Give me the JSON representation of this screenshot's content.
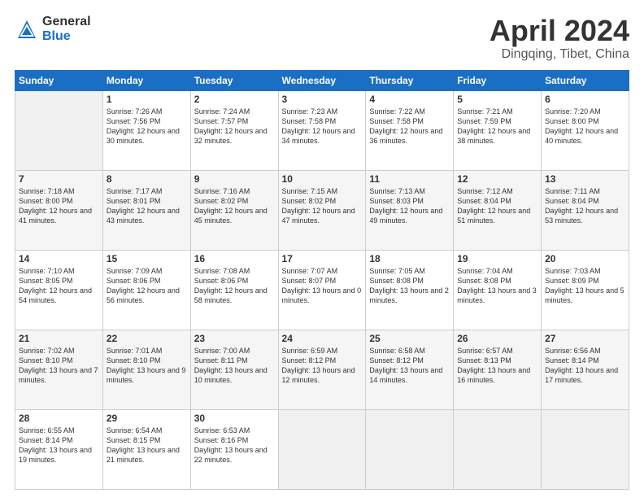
{
  "header": {
    "logo_general": "General",
    "logo_blue": "Blue",
    "title": "April 2024",
    "subtitle": "Dingqing, Tibet, China"
  },
  "weekdays": [
    "Sunday",
    "Monday",
    "Tuesday",
    "Wednesday",
    "Thursday",
    "Friday",
    "Saturday"
  ],
  "weeks": [
    [
      {
        "day": "",
        "sunrise": "",
        "sunset": "",
        "daylight": ""
      },
      {
        "day": "1",
        "sunrise": "Sunrise: 7:26 AM",
        "sunset": "Sunset: 7:56 PM",
        "daylight": "Daylight: 12 hours and 30 minutes."
      },
      {
        "day": "2",
        "sunrise": "Sunrise: 7:24 AM",
        "sunset": "Sunset: 7:57 PM",
        "daylight": "Daylight: 12 hours and 32 minutes."
      },
      {
        "day": "3",
        "sunrise": "Sunrise: 7:23 AM",
        "sunset": "Sunset: 7:58 PM",
        "daylight": "Daylight: 12 hours and 34 minutes."
      },
      {
        "day": "4",
        "sunrise": "Sunrise: 7:22 AM",
        "sunset": "Sunset: 7:58 PM",
        "daylight": "Daylight: 12 hours and 36 minutes."
      },
      {
        "day": "5",
        "sunrise": "Sunrise: 7:21 AM",
        "sunset": "Sunset: 7:59 PM",
        "daylight": "Daylight: 12 hours and 38 minutes."
      },
      {
        "day": "6",
        "sunrise": "Sunrise: 7:20 AM",
        "sunset": "Sunset: 8:00 PM",
        "daylight": "Daylight: 12 hours and 40 minutes."
      }
    ],
    [
      {
        "day": "7",
        "sunrise": "Sunrise: 7:18 AM",
        "sunset": "Sunset: 8:00 PM",
        "daylight": "Daylight: 12 hours and 41 minutes."
      },
      {
        "day": "8",
        "sunrise": "Sunrise: 7:17 AM",
        "sunset": "Sunset: 8:01 PM",
        "daylight": "Daylight: 12 hours and 43 minutes."
      },
      {
        "day": "9",
        "sunrise": "Sunrise: 7:16 AM",
        "sunset": "Sunset: 8:02 PM",
        "daylight": "Daylight: 12 hours and 45 minutes."
      },
      {
        "day": "10",
        "sunrise": "Sunrise: 7:15 AM",
        "sunset": "Sunset: 8:02 PM",
        "daylight": "Daylight: 12 hours and 47 minutes."
      },
      {
        "day": "11",
        "sunrise": "Sunrise: 7:13 AM",
        "sunset": "Sunset: 8:03 PM",
        "daylight": "Daylight: 12 hours and 49 minutes."
      },
      {
        "day": "12",
        "sunrise": "Sunrise: 7:12 AM",
        "sunset": "Sunset: 8:04 PM",
        "daylight": "Daylight: 12 hours and 51 minutes."
      },
      {
        "day": "13",
        "sunrise": "Sunrise: 7:11 AM",
        "sunset": "Sunset: 8:04 PM",
        "daylight": "Daylight: 12 hours and 53 minutes."
      }
    ],
    [
      {
        "day": "14",
        "sunrise": "Sunrise: 7:10 AM",
        "sunset": "Sunset: 8:05 PM",
        "daylight": "Daylight: 12 hours and 54 minutes."
      },
      {
        "day": "15",
        "sunrise": "Sunrise: 7:09 AM",
        "sunset": "Sunset: 8:06 PM",
        "daylight": "Daylight: 12 hours and 56 minutes."
      },
      {
        "day": "16",
        "sunrise": "Sunrise: 7:08 AM",
        "sunset": "Sunset: 8:06 PM",
        "daylight": "Daylight: 12 hours and 58 minutes."
      },
      {
        "day": "17",
        "sunrise": "Sunrise: 7:07 AM",
        "sunset": "Sunset: 8:07 PM",
        "daylight": "Daylight: 13 hours and 0 minutes."
      },
      {
        "day": "18",
        "sunrise": "Sunrise: 7:05 AM",
        "sunset": "Sunset: 8:08 PM",
        "daylight": "Daylight: 13 hours and 2 minutes."
      },
      {
        "day": "19",
        "sunrise": "Sunrise: 7:04 AM",
        "sunset": "Sunset: 8:08 PM",
        "daylight": "Daylight: 13 hours and 3 minutes."
      },
      {
        "day": "20",
        "sunrise": "Sunrise: 7:03 AM",
        "sunset": "Sunset: 8:09 PM",
        "daylight": "Daylight: 13 hours and 5 minutes."
      }
    ],
    [
      {
        "day": "21",
        "sunrise": "Sunrise: 7:02 AM",
        "sunset": "Sunset: 8:10 PM",
        "daylight": "Daylight: 13 hours and 7 minutes."
      },
      {
        "day": "22",
        "sunrise": "Sunrise: 7:01 AM",
        "sunset": "Sunset: 8:10 PM",
        "daylight": "Daylight: 13 hours and 9 minutes."
      },
      {
        "day": "23",
        "sunrise": "Sunrise: 7:00 AM",
        "sunset": "Sunset: 8:11 PM",
        "daylight": "Daylight: 13 hours and 10 minutes."
      },
      {
        "day": "24",
        "sunrise": "Sunrise: 6:59 AM",
        "sunset": "Sunset: 8:12 PM",
        "daylight": "Daylight: 13 hours and 12 minutes."
      },
      {
        "day": "25",
        "sunrise": "Sunrise: 6:58 AM",
        "sunset": "Sunset: 8:12 PM",
        "daylight": "Daylight: 13 hours and 14 minutes."
      },
      {
        "day": "26",
        "sunrise": "Sunrise: 6:57 AM",
        "sunset": "Sunset: 8:13 PM",
        "daylight": "Daylight: 13 hours and 16 minutes."
      },
      {
        "day": "27",
        "sunrise": "Sunrise: 6:56 AM",
        "sunset": "Sunset: 8:14 PM",
        "daylight": "Daylight: 13 hours and 17 minutes."
      }
    ],
    [
      {
        "day": "28",
        "sunrise": "Sunrise: 6:55 AM",
        "sunset": "Sunset: 8:14 PM",
        "daylight": "Daylight: 13 hours and 19 minutes."
      },
      {
        "day": "29",
        "sunrise": "Sunrise: 6:54 AM",
        "sunset": "Sunset: 8:15 PM",
        "daylight": "Daylight: 13 hours and 21 minutes."
      },
      {
        "day": "30",
        "sunrise": "Sunrise: 6:53 AM",
        "sunset": "Sunset: 8:16 PM",
        "daylight": "Daylight: 13 hours and 22 minutes."
      },
      {
        "day": "",
        "sunrise": "",
        "sunset": "",
        "daylight": ""
      },
      {
        "day": "",
        "sunrise": "",
        "sunset": "",
        "daylight": ""
      },
      {
        "day": "",
        "sunrise": "",
        "sunset": "",
        "daylight": ""
      },
      {
        "day": "",
        "sunrise": "",
        "sunset": "",
        "daylight": ""
      }
    ]
  ]
}
